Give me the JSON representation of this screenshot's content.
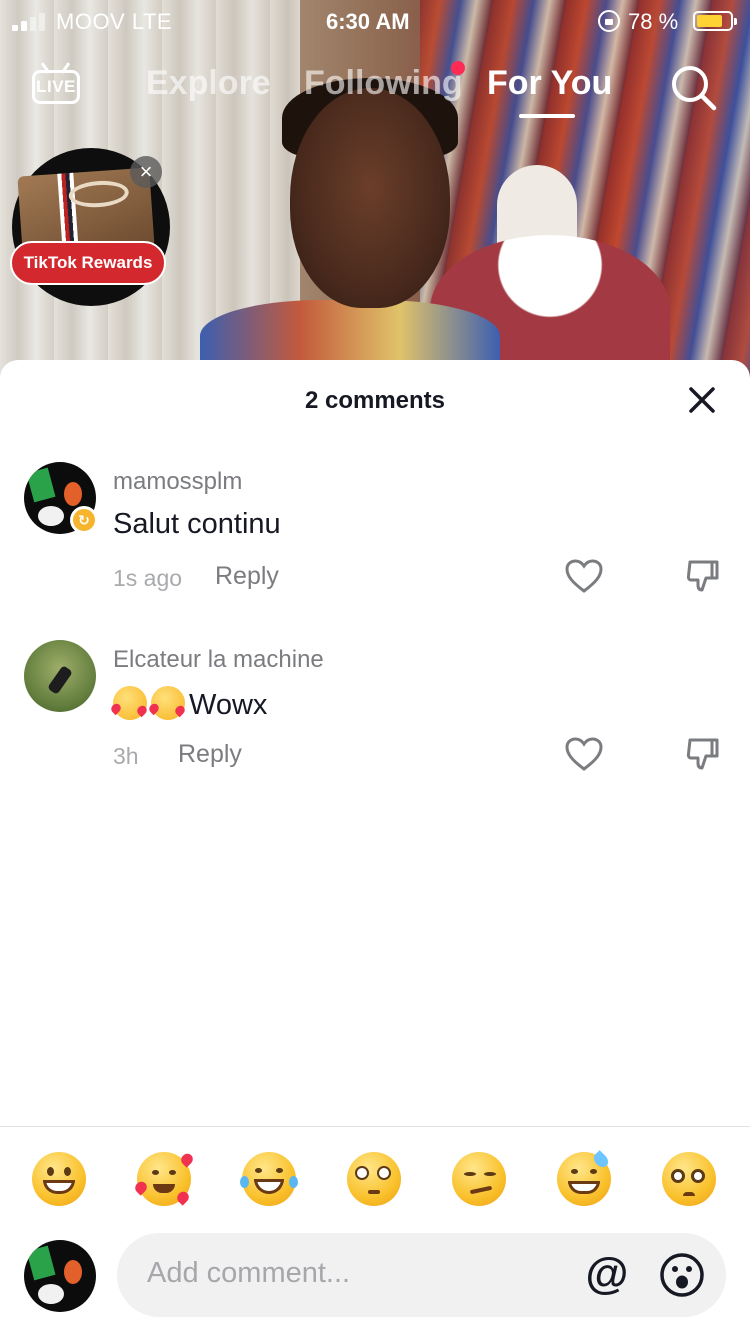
{
  "status_bar": {
    "carrier": "MOOV  LTE",
    "time": "6:30 AM",
    "battery_percent": "78 %",
    "battery_level": 0.78,
    "signal_bars_active": 2,
    "signal_bars_total": 4
  },
  "top_nav": {
    "live_label": "LIVE",
    "tabs": [
      {
        "label": "Explore",
        "active": false
      },
      {
        "label": "Following",
        "active": false,
        "has_notification_dot": true
      },
      {
        "label": "For You",
        "active": true
      }
    ],
    "search_icon": "search-icon"
  },
  "rewards_badge": {
    "label": "TikTok Rewards",
    "close_symbol": "×"
  },
  "comments_sheet": {
    "title": "2 comments",
    "close_icon": "close-icon",
    "comments": [
      {
        "username": "mamossplm",
        "text": "Salut continu",
        "time": "1s ago",
        "reply_label": "Reply",
        "avatar_badge": "refresh-badge"
      },
      {
        "username": "Elcateur la machine",
        "text": "Wowx",
        "emoji_prefix": [
          "smiling-face-with-hearts",
          "smiling-face-with-hearts"
        ],
        "time": "3h",
        "reply_label": "Reply"
      }
    ],
    "quick_emojis": [
      "grinning-face",
      "smiling-face-with-hearts",
      "face-with-tears-of-joy",
      "flushed-face",
      "smirking-face",
      "grinning-sweat-face",
      "pleading-face"
    ],
    "input": {
      "placeholder": "Add comment...",
      "mention_symbol": "@",
      "emoji_icon": "emoji-icon"
    }
  },
  "colors": {
    "accent_dot": "#fe2c55",
    "rewards_red": "#d3282e",
    "text_primary": "#161823",
    "text_secondary": "#7b7c80",
    "battery_fill": "#ffd234"
  }
}
